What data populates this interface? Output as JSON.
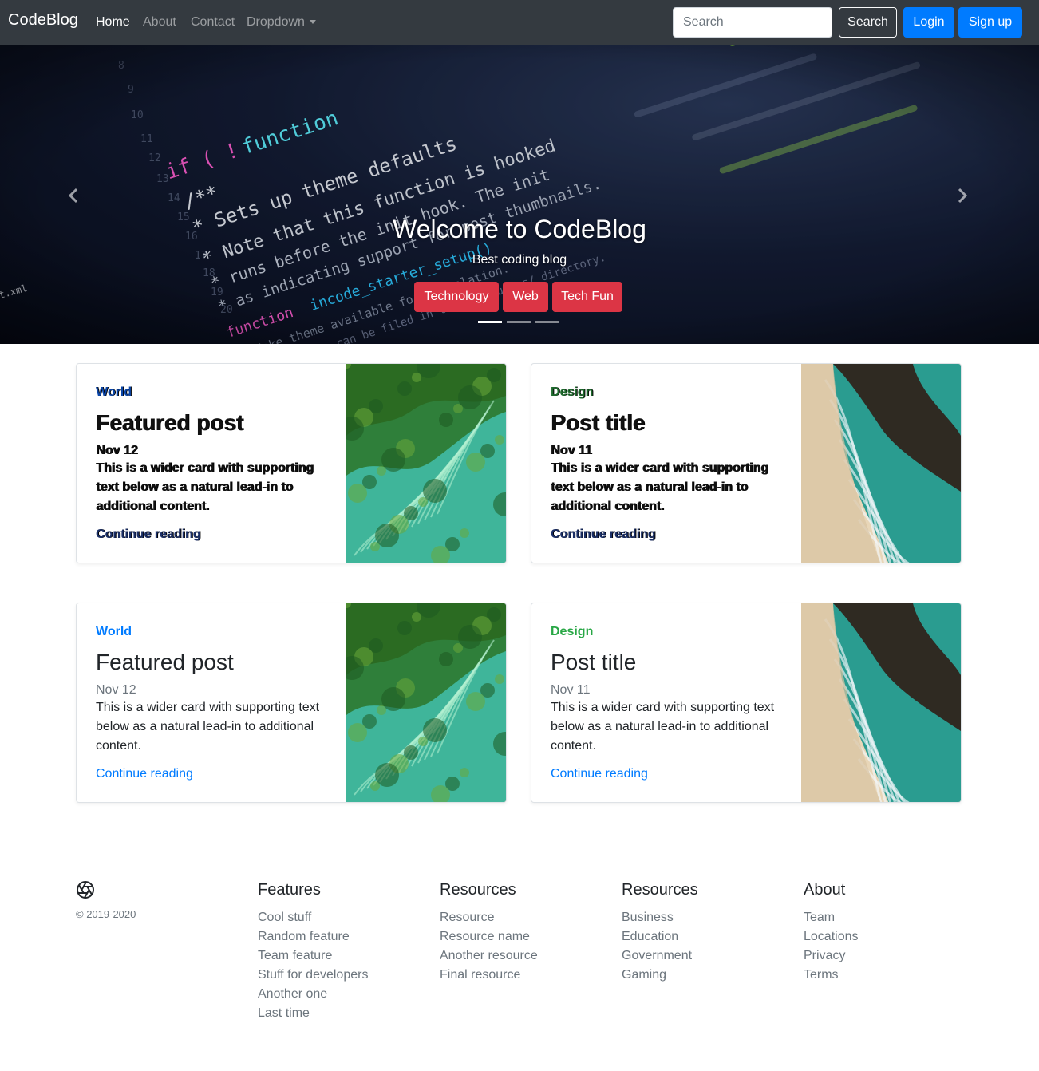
{
  "navbar": {
    "brand": "CodeBlog",
    "links": [
      "Home",
      "About",
      "Contact",
      "Dropdown"
    ],
    "search_placeholder": "Search",
    "search_button": "Search",
    "login_button": "Login",
    "signup_button": "Sign up"
  },
  "hero": {
    "title": "Welcome to CodeBlog",
    "subtitle": "Best coding blog",
    "tags": [
      "Technology",
      "Web",
      "Tech Fun"
    ],
    "indicators": 3,
    "active_indicator": 0
  },
  "cards": [
    {
      "category": "World",
      "category_color": "#007bff",
      "title": "Featured post",
      "date": "Nov 12",
      "text": "This is a wider card with supporting text below as a natural lead-in to additional content.",
      "link": "Continue reading",
      "image": "green-sea-aerial"
    },
    {
      "category": "Design",
      "category_color": "#28a745",
      "title": "Post title",
      "date": "Nov 11",
      "text": "This is a wider card with supporting text below as a natural lead-in to additional content.",
      "link": "Continue reading",
      "image": "beach-aerial"
    },
    {
      "category": "World",
      "category_color": "#007bff",
      "title": "Featured post",
      "date": "Nov 12",
      "text": "This is a wider card with supporting text below as a natural lead-in to additional content.",
      "link": "Continue reading",
      "image": "green-sea-aerial"
    },
    {
      "category": "Design",
      "category_color": "#28a745",
      "title": "Post title",
      "date": "Nov 11",
      "text": "This is a wider card with supporting text below as a natural lead-in to additional content.",
      "link": "Continue reading",
      "image": "beach-aerial"
    }
  ],
  "footer": {
    "copyright": "© 2019-2020",
    "logo_icon": "aperture-icon",
    "columns": [
      {
        "heading": "Features",
        "items": [
          "Cool stuff",
          "Random feature",
          "Team feature",
          "Stuff for developers",
          "Another one",
          "Last time"
        ]
      },
      {
        "heading": "Resources",
        "items": [
          "Resource",
          "Resource name",
          "Another resource",
          "Final resource"
        ]
      },
      {
        "heading": "Resources",
        "items": [
          "Business",
          "Education",
          "Government",
          "Gaming"
        ]
      },
      {
        "heading": "About",
        "items": [
          "Team",
          "Locations",
          "Privacy",
          "Terms"
        ]
      }
    ]
  }
}
